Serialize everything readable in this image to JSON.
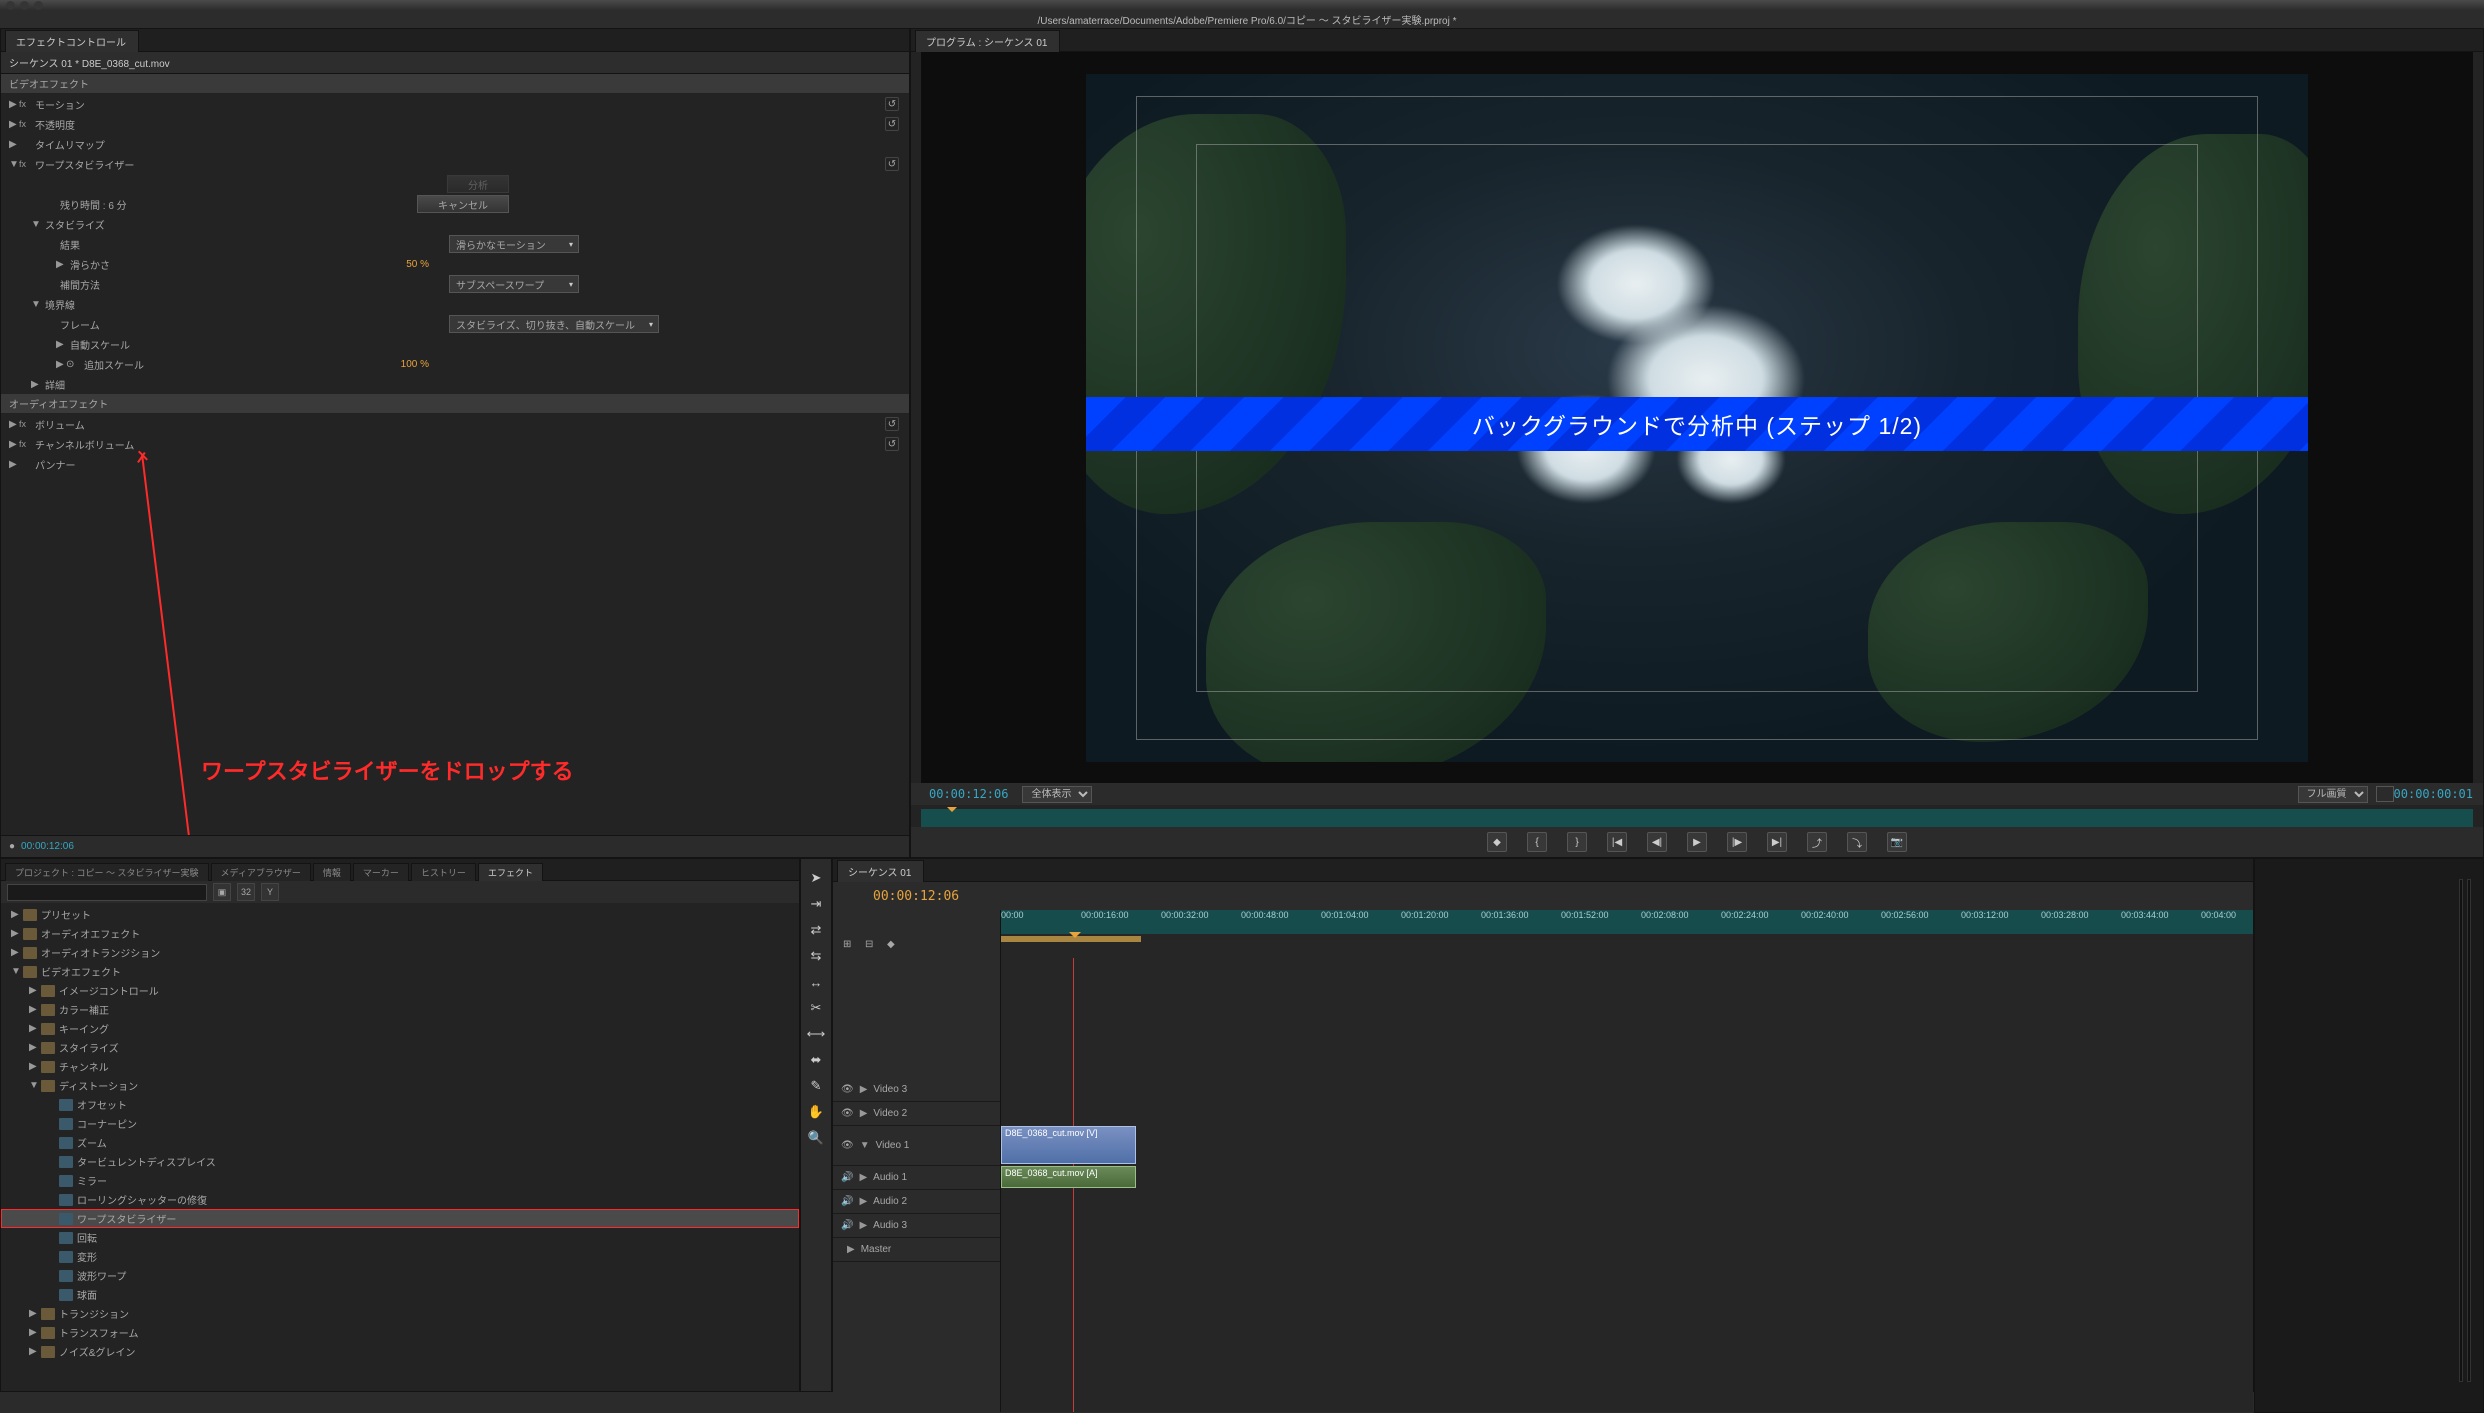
{
  "title_path": "/Users/amaterrace/Documents/Adobe/Premiere Pro/6.0/コピー ～ スタビライザー実験.prproj *",
  "effect_controls": {
    "tab": "エフェクトコントロール",
    "header": "シーケンス 01 * D8E_0368_cut.mov",
    "video_fx_label": "ビデオエフェクト",
    "audio_fx_label": "オーディオエフェクト",
    "motion": "モーション",
    "opacity": "不透明度",
    "time_remap": "タイムリマップ",
    "warp": "ワープスタビライザー",
    "remaining": "残り時間 : 6 分",
    "stabilize": "スタビライズ",
    "result": "結果",
    "result_val": "滑らかなモーション",
    "smoothness": "滑らかさ",
    "smoothness_val": "50 %",
    "method": "補間方法",
    "method_val": "サブスペースワープ",
    "border": "境界線",
    "frame": "フレーム",
    "frame_val": "スタビライズ、切り抜き、自動スケール",
    "autoscale": "自動スケール",
    "addscale": "追加スケール",
    "addscale_val": "100 %",
    "detail": "詳細",
    "analyze_btn": "分析",
    "cancel_btn": "キャンセル",
    "volume": "ボリューム",
    "ch_volume": "チャンネルボリューム",
    "panner": "パンナー",
    "footer_tc": "00:00:12:06"
  },
  "program": {
    "tab": "プログラム : シーケンス 01",
    "banner": "バックグラウンドで分析中 (ステップ 1/2)",
    "tc_left": "00:00:12:06",
    "fit": "全体表示",
    "quality": "フル画質",
    "tc_right": "00:00:00:01"
  },
  "annotation": "ワープスタビライザーをドロップする",
  "project": {
    "tabs": [
      "プロジェクト : コピー ～ スタビライザー実験",
      "メディアブラウザー",
      "情報",
      "マーカー",
      "ヒストリー",
      "エフェクト"
    ],
    "active_tab": 5,
    "tree": [
      {
        "d": 0,
        "tw": "▶",
        "ico": "f",
        "label": "プリセット"
      },
      {
        "d": 0,
        "tw": "▶",
        "ico": "f",
        "label": "オーディオエフェクト"
      },
      {
        "d": 0,
        "tw": "▶",
        "ico": "f",
        "label": "オーディオトランジション"
      },
      {
        "d": 0,
        "tw": "▼",
        "ico": "f",
        "label": "ビデオエフェクト"
      },
      {
        "d": 1,
        "tw": "▶",
        "ico": "f",
        "label": "イメージコントロール"
      },
      {
        "d": 1,
        "tw": "▶",
        "ico": "f",
        "label": "カラー補正"
      },
      {
        "d": 1,
        "tw": "▶",
        "ico": "f",
        "label": "キーイング"
      },
      {
        "d": 1,
        "tw": "▶",
        "ico": "f",
        "label": "スタイライズ"
      },
      {
        "d": 1,
        "tw": "▶",
        "ico": "f",
        "label": "チャンネル"
      },
      {
        "d": 1,
        "tw": "▼",
        "ico": "f",
        "label": "ディストーション"
      },
      {
        "d": 2,
        "tw": "",
        "ico": "fx",
        "label": "オフセット"
      },
      {
        "d": 2,
        "tw": "",
        "ico": "fx",
        "label": "コーナーピン"
      },
      {
        "d": 2,
        "tw": "",
        "ico": "fx",
        "label": "ズーム"
      },
      {
        "d": 2,
        "tw": "",
        "ico": "fx",
        "label": "タービュレントディスプレイス"
      },
      {
        "d": 2,
        "tw": "",
        "ico": "fx",
        "label": "ミラー"
      },
      {
        "d": 2,
        "tw": "",
        "ico": "fx",
        "label": "ローリングシャッターの修復"
      },
      {
        "d": 2,
        "tw": "",
        "ico": "fx",
        "label": "ワープスタビライザー",
        "selected": true
      },
      {
        "d": 2,
        "tw": "",
        "ico": "fx",
        "label": "回転"
      },
      {
        "d": 2,
        "tw": "",
        "ico": "fx",
        "label": "変形"
      },
      {
        "d": 2,
        "tw": "",
        "ico": "fx",
        "label": "波形ワープ"
      },
      {
        "d": 2,
        "tw": "",
        "ico": "fx",
        "label": "球面"
      },
      {
        "d": 1,
        "tw": "▶",
        "ico": "f",
        "label": "トランジション"
      },
      {
        "d": 1,
        "tw": "▶",
        "ico": "f",
        "label": "トランスフォーム"
      },
      {
        "d": 1,
        "tw": "▶",
        "ico": "f",
        "label": "ノイズ&グレイン"
      }
    ]
  },
  "timeline": {
    "tab": "シーケンス 01",
    "tc": "00:00:12:06",
    "ticks": [
      "00:00",
      "00:00:16:00",
      "00:00:32:00",
      "00:00:48:00",
      "00:01:04:00",
      "00:01:20:00",
      "00:01:36:00",
      "00:01:52:00",
      "00:02:08:00",
      "00:02:24:00",
      "00:02:40:00",
      "00:02:56:00",
      "00:03:12:00",
      "00:03:28:00",
      "00:03:44:00",
      "00:04:00"
    ],
    "tracks": {
      "v3": "Video 3",
      "v2": "Video 2",
      "v1": "Video 1",
      "a1": "Audio 1",
      "a2": "Audio 2",
      "a3": "Audio 3",
      "master": "Master"
    },
    "clip_v": "D8E_0368_cut.mov [V]",
    "clip_a": "D8E_0368_cut.mov [A]"
  }
}
